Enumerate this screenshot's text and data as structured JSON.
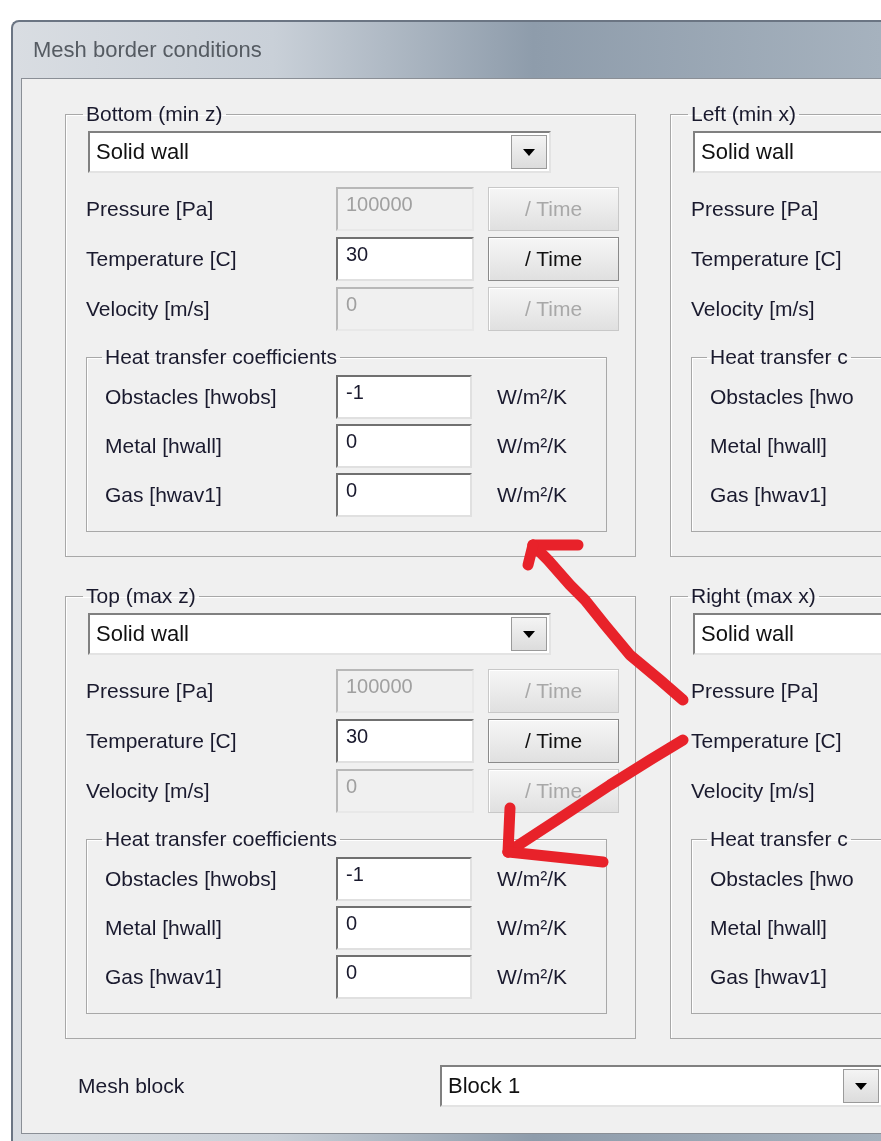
{
  "window": {
    "title": "Mesh border conditions"
  },
  "panels": [
    {
      "title": "Bottom (min z)",
      "type": "Solid wall",
      "fields": [
        {
          "label": "Pressure [Pa]",
          "value": "100000",
          "disabled": true,
          "button": "/ Time"
        },
        {
          "label": "Temperature [C]",
          "value": "30",
          "disabled": false,
          "button": "/ Time"
        },
        {
          "label": "Velocity [m/s]",
          "value": "0",
          "disabled": true,
          "button": "/ Time"
        }
      ],
      "heat": {
        "title": "Heat transfer coefficients",
        "rows": [
          {
            "label": "Obstacles [hwobs]",
            "value": "-1",
            "unit": "W/m²/K"
          },
          {
            "label": "Metal [hwall]",
            "value": "0",
            "unit": "W/m²/K"
          },
          {
            "label": "Gas [hwav1]",
            "value": "0",
            "unit": "W/m²/K"
          }
        ]
      }
    },
    {
      "title": "Left  (min x)",
      "type": "Solid wall",
      "fields": [
        {
          "label": "Pressure [Pa]"
        },
        {
          "label": "Temperature [C]"
        },
        {
          "label": "Velocity [m/s]"
        }
      ],
      "heat": {
        "title": "Heat transfer c",
        "rows": [
          {
            "label": "Obstacles [hwo"
          },
          {
            "label": "Metal [hwall]"
          },
          {
            "label": "Gas [hwav1]"
          }
        ]
      }
    },
    {
      "title": "Top (max z)",
      "type": "Solid wall",
      "fields": [
        {
          "label": "Pressure [Pa]",
          "value": "100000",
          "disabled": true,
          "button": "/ Time"
        },
        {
          "label": "Temperature [C]",
          "value": "30",
          "disabled": false,
          "button": "/ Time"
        },
        {
          "label": "Velocity [m/s]",
          "value": "0",
          "disabled": true,
          "button": "/ Time"
        }
      ],
      "heat": {
        "title": "Heat transfer coefficients",
        "rows": [
          {
            "label": "Obstacles [hwobs]",
            "value": "-1",
            "unit": "W/m²/K"
          },
          {
            "label": "Metal [hwall]",
            "value": "0",
            "unit": "W/m²/K"
          },
          {
            "label": "Gas [hwav1]",
            "value": "0",
            "unit": "W/m²/K"
          }
        ]
      }
    },
    {
      "title": "Right (max x)",
      "type": "Solid wall",
      "fields": [
        {
          "label": "Pressure [Pa]"
        },
        {
          "label": "Temperature [C]"
        },
        {
          "label": "Velocity [m/s]"
        }
      ],
      "heat": {
        "title": "Heat transfer c",
        "rows": [
          {
            "label": "Obstacles [hwo"
          },
          {
            "label": "Metal [hwall]"
          },
          {
            "label": "Gas [hwav1]"
          }
        ]
      }
    }
  ],
  "mesh_block": {
    "label": "Mesh block",
    "value": "Block 1"
  }
}
